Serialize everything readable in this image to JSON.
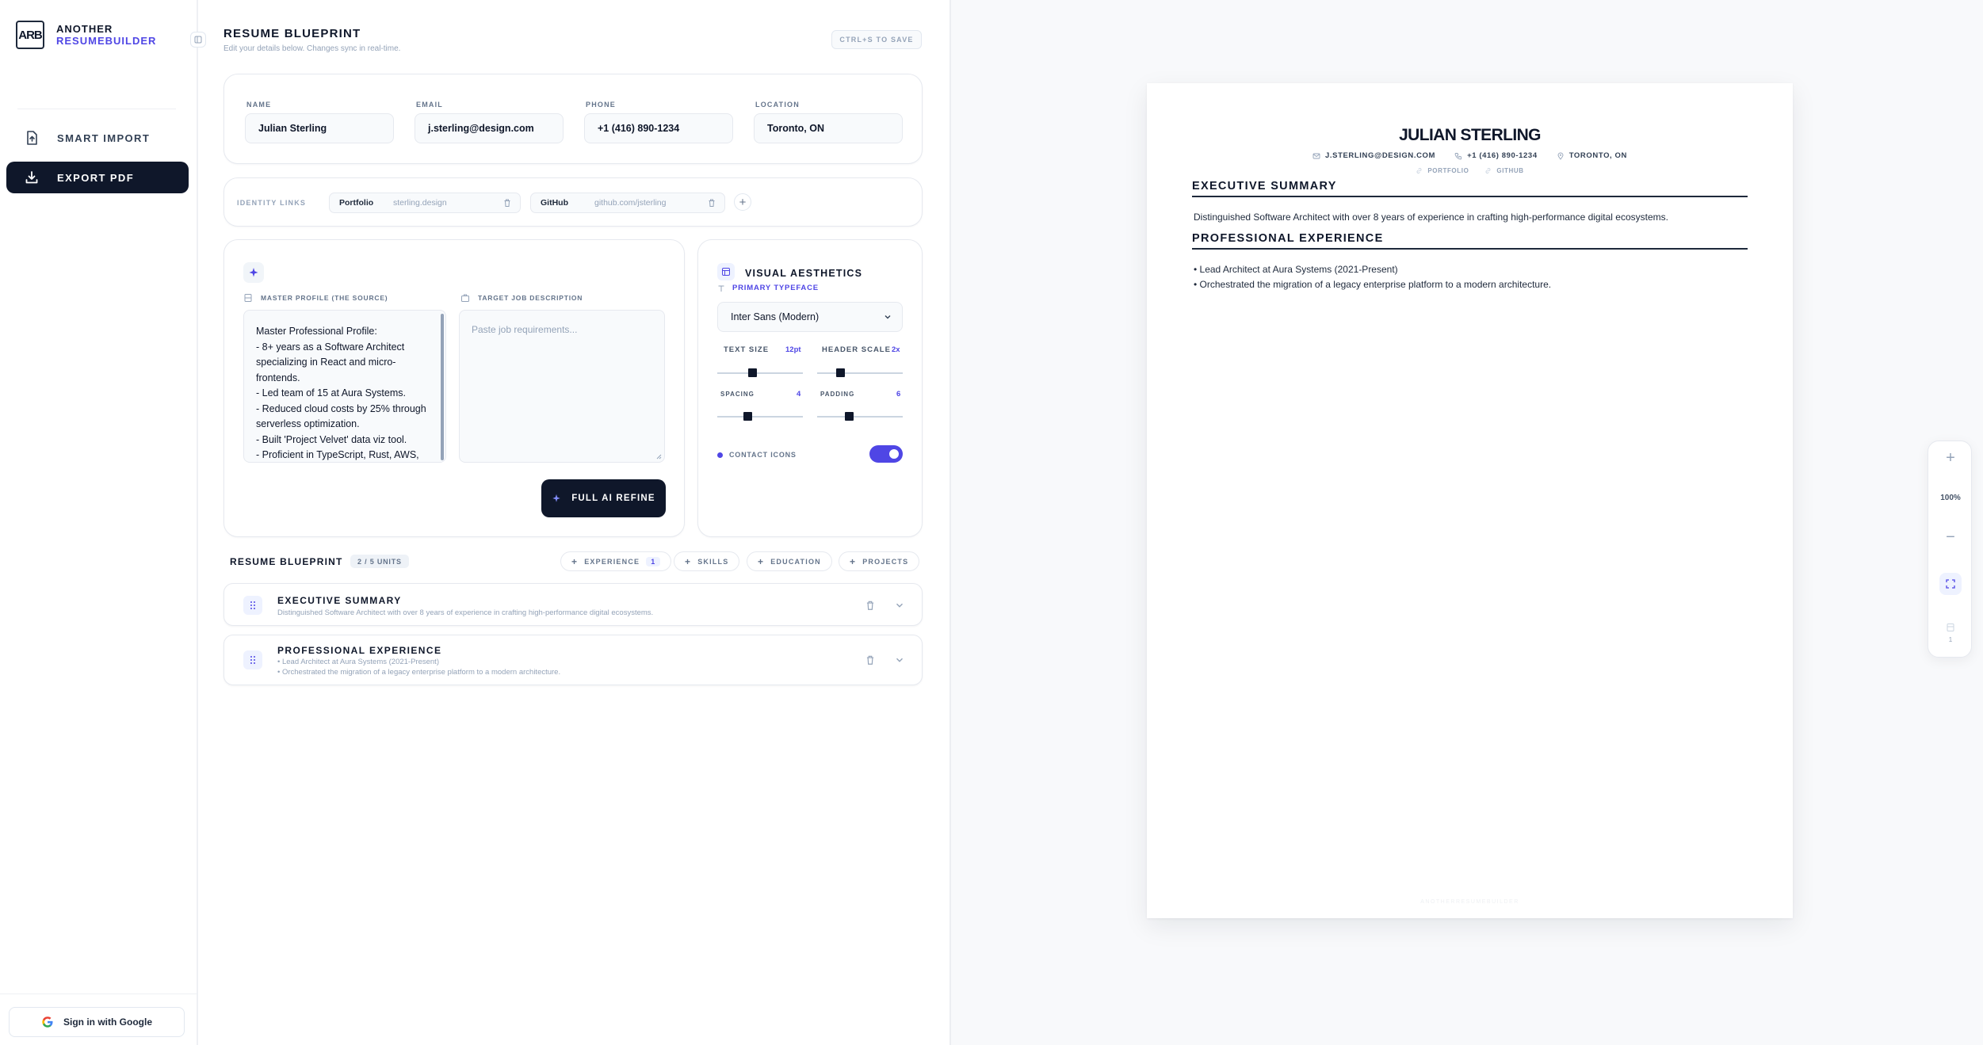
{
  "brand": {
    "logo": "ARB",
    "line1": "ANOTHER",
    "line2": "RESUMEBUILDER"
  },
  "sidebar": {
    "items": [
      {
        "label": "SMART IMPORT",
        "icon": "file-upload-icon"
      },
      {
        "label": "EXPORT PDF",
        "icon": "download-icon"
      }
    ],
    "signin": "Sign in with Google"
  },
  "editor": {
    "title": "RESUME BLUEPRINT",
    "subtitle": "Edit your details below. Changes sync in real-time.",
    "save_hint": "CTRL+S TO SAVE",
    "fields": {
      "name": {
        "label": "NAME",
        "value": "Julian Sterling"
      },
      "email": {
        "label": "EMAIL",
        "value": "j.sterling@design.com"
      },
      "phone": {
        "label": "PHONE",
        "value": "+1 (416) 890-1234"
      },
      "location": {
        "label": "LOCATION",
        "value": "Toronto, ON"
      }
    },
    "identity_links": {
      "label": "IDENTITY LINKS",
      "links": [
        {
          "name": "Portfolio",
          "url": "sterling.design"
        },
        {
          "name": "GitHub",
          "url": "github.com/jsterling"
        }
      ]
    },
    "ai": {
      "master_label": "MASTER PROFILE (THE SOURCE)",
      "master_text": "Master Professional Profile:\n- 8+ years as a Software Architect specializing in React and micro-frontends.\n- Led team of 15 at Aura Systems.\n- Reduced cloud costs by 25% through serverless optimization.\n- Built 'Project Velvet' data viz tool.\n- Proficient in TypeScript, Rust, AWS,",
      "target_label": "TARGET JOB DESCRIPTION",
      "target_placeholder": "Paste job requirements...",
      "refine_button": "FULL AI REFINE"
    },
    "aesthetics": {
      "title": "VISUAL AESTHETICS",
      "typeface_label": "PRIMARY TYPEFACE",
      "typeface_value": "Inter Sans (Modern)",
      "text_size_label": "TEXT SIZE",
      "text_size_value": "12pt",
      "header_scale_label": "HEADER SCALE",
      "header_scale_value": "2x",
      "spacing_label": "SPACING",
      "spacing_value": "4",
      "padding_label": "PADDING",
      "padding_value": "6",
      "contact_icons_label": "CONTACT ICONS",
      "contact_icons_on": true
    },
    "blueprint": {
      "title": "RESUME BLUEPRINT",
      "units": "2 / 5 UNITS",
      "add_buttons": [
        {
          "label": "EXPERIENCE",
          "count": "1"
        },
        {
          "label": "SKILLS"
        },
        {
          "label": "EDUCATION"
        },
        {
          "label": "PROJECTS"
        }
      ],
      "sections": [
        {
          "title": "EXECUTIVE SUMMARY",
          "desc": "Distinguished Software Architect with over 8 years of experience in crafting high-performance digital ecosystems."
        },
        {
          "title": "PROFESSIONAL EXPERIENCE",
          "desc1": "• Lead Architect at Aura Systems (2021-Present)",
          "desc2": "• Orchestrated the migration of a legacy enterprise platform to a modern architecture."
        }
      ]
    }
  },
  "preview": {
    "name": "JULIAN STERLING",
    "email": "J.STERLING@DESIGN.COM",
    "phone": "+1 (416) 890-1234",
    "location": "TORONTO, ON",
    "links": [
      "PORTFOLIO",
      "GITHUB"
    ],
    "summary_heading": "EXECUTIVE SUMMARY",
    "summary_text": "Distinguished Software Architect with over 8 years of experience in crafting high-performance digital ecosystems.",
    "experience_heading": "PROFESSIONAL EXPERIENCE",
    "experience_items": [
      "• Lead Architect at Aura Systems (2021-Present)",
      "• Orchestrated the migration of a legacy enterprise platform to a modern architecture."
    ],
    "footer": "ANOTHERRESUMEBUILDER",
    "zoom": "100%",
    "page": "1"
  },
  "colors": {
    "accent": "#4f46e5",
    "dark": "#0f172a"
  }
}
